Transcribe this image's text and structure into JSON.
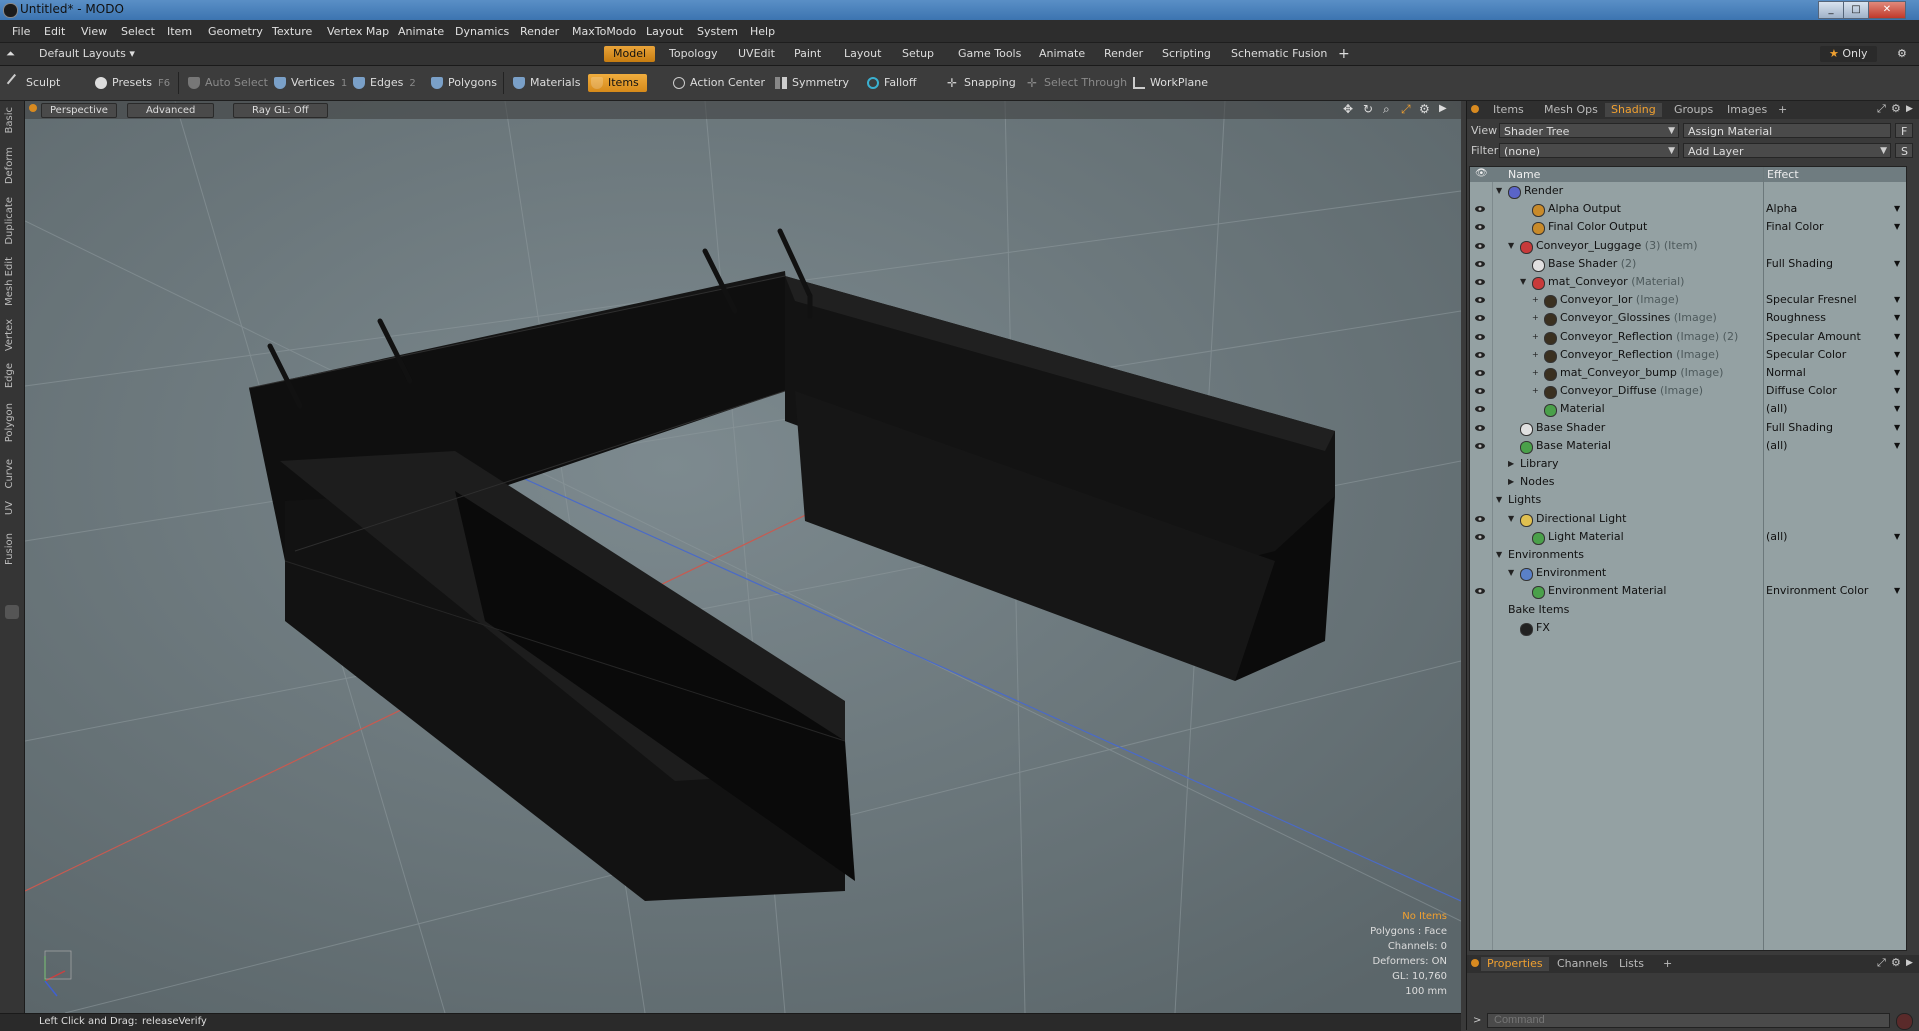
{
  "window": {
    "title": "Untitled* - MODO"
  },
  "menu": [
    "File",
    "Edit",
    "View",
    "Select",
    "Item",
    "Geometry",
    "Texture",
    "Vertex Map",
    "Animate",
    "Dynamics",
    "Render",
    "MaxToModo",
    "Layout",
    "System",
    "Help"
  ],
  "layoutbar": {
    "layout_name": "Default Layouts",
    "tabs": [
      "Model",
      "Topology",
      "UVEdit",
      "Paint",
      "Layout",
      "Setup",
      "Game Tools",
      "Animate",
      "Render",
      "Scripting",
      "Schematic Fusion"
    ],
    "active_tab": "Model",
    "add": "+",
    "only": "Only"
  },
  "toolbar": {
    "sculpt": "Sculpt",
    "presets": "Presets",
    "presets_key": "F6",
    "auto_select": "Auto Select",
    "vertices": "Vertices",
    "vertices_key": "1",
    "edges": "Edges",
    "edges_key": "2",
    "polygons": "Polygons",
    "materials": "Materials",
    "items": "Items",
    "action_center": "Action Center",
    "symmetry": "Symmetry",
    "falloff": "Falloff",
    "snapping": "Snapping",
    "select_through": "Select Through",
    "workplane": "WorkPlane"
  },
  "left_tabs": [
    "Basic",
    "Deform",
    "Duplicate",
    "Mesh Edit",
    "Vertex",
    "Edge",
    "Polygon",
    "Curve",
    "UV",
    "Fusion"
  ],
  "viewport": {
    "perspective": "Perspective",
    "advanced": "Advanced",
    "raygl": "Ray GL: Off",
    "stats": {
      "no_items": "No Items",
      "polygons": "Polygons : Face",
      "channels": "Channels: 0",
      "deformers": "Deformers: ON",
      "gl": "GL: 10,760",
      "scale": "100 mm"
    }
  },
  "statusbar": {
    "hint": "Left Click and Drag:",
    "action": "releaseVerify"
  },
  "panel": {
    "tabs": [
      "Items",
      "Mesh Ops",
      "Shading",
      "Groups",
      "Images"
    ],
    "active_tab": "Shading",
    "add": "+",
    "view_label": "View",
    "view_value": "Shader Tree",
    "assign_material": "Assign Material",
    "assign_key": "F",
    "filter_label": "Filter",
    "filter_value": "(none)",
    "add_layer": "Add Layer",
    "add_layer_key": "S",
    "col_name": "Name",
    "col_effect": "Effect",
    "rows": [
      {
        "name": "Render",
        "sub": "",
        "effect": "",
        "indent": 0,
        "tri": "▼",
        "icon": "#5a64c8",
        "eye": false
      },
      {
        "name": "Alpha Output",
        "sub": "",
        "effect": "Alpha",
        "indent": 2,
        "tri": "",
        "icon": "#c88a2a",
        "eye": true
      },
      {
        "name": "Final Color Output",
        "sub": "",
        "effect": "Final Color",
        "indent": 2,
        "tri": "",
        "icon": "#c88a2a",
        "eye": true
      },
      {
        "name": "Conveyor_Luggage",
        "sub": " (3) (Item)",
        "effect": "",
        "indent": 1,
        "tri": "▼",
        "icon": "#c83a3a",
        "eye": true
      },
      {
        "name": "Base Shader",
        "sub": " (2)",
        "effect": "Full Shading",
        "indent": 2,
        "tri": "",
        "icon": "#e0e0e0",
        "eye": true
      },
      {
        "name": "mat_Conveyor",
        "sub": " (Material)",
        "effect": "",
        "indent": 2,
        "tri": "▼",
        "icon": "#c83a3a",
        "eye": true
      },
      {
        "name": "Conveyor_Ior",
        "sub": " (Image)",
        "effect": "Specular Fresnel",
        "indent": 3,
        "tri": "+",
        "icon": "#3a3020",
        "eye": true
      },
      {
        "name": "Conveyor_Glossines",
        "sub": " (Image)",
        "effect": "Roughness",
        "indent": 3,
        "tri": "+",
        "icon": "#3a3020",
        "eye": true
      },
      {
        "name": "Conveyor_Reflection",
        "sub": " (Image) (2)",
        "effect": "Specular Amount",
        "indent": 3,
        "tri": "+",
        "icon": "#3a3020",
        "eye": true
      },
      {
        "name": "Conveyor_Reflection",
        "sub": " (Image)",
        "effect": "Specular Color",
        "indent": 3,
        "tri": "+",
        "icon": "#3a3020",
        "eye": true
      },
      {
        "name": "mat_Conveyor_bump",
        "sub": " (Image)",
        "effect": "Normal",
        "indent": 3,
        "tri": "+",
        "icon": "#3a3020",
        "eye": true
      },
      {
        "name": "Conveyor_Diffuse",
        "sub": " (Image)",
        "effect": "Diffuse Color",
        "indent": 3,
        "tri": "+",
        "icon": "#3a3020",
        "eye": true
      },
      {
        "name": "Material",
        "sub": "",
        "effect": "(all)",
        "indent": 3,
        "tri": "",
        "icon": "#4aa04a",
        "eye": true
      },
      {
        "name": "Base Shader",
        "sub": "",
        "effect": "Full Shading",
        "indent": 1,
        "tri": "",
        "icon": "#e0e0e0",
        "eye": true
      },
      {
        "name": "Base Material",
        "sub": "",
        "effect": "(all)",
        "indent": 1,
        "tri": "",
        "icon": "#4aa04a",
        "eye": true
      },
      {
        "name": "Library",
        "sub": "",
        "effect": "",
        "indent": 1,
        "tri": "▶",
        "icon": "",
        "eye": false
      },
      {
        "name": "Nodes",
        "sub": "",
        "effect": "",
        "indent": 1,
        "tri": "▶",
        "icon": "",
        "eye": false
      },
      {
        "name": "Lights",
        "sub": "",
        "effect": "",
        "indent": 0,
        "tri": "▼",
        "icon": "",
        "eye": false
      },
      {
        "name": "Directional Light",
        "sub": "",
        "effect": "",
        "indent": 1,
        "tri": "▼",
        "icon": "#e0c050",
        "eye": true
      },
      {
        "name": "Light Material",
        "sub": "",
        "effect": "(all)",
        "indent": 2,
        "tri": "",
        "icon": "#4aa04a",
        "eye": true
      },
      {
        "name": "Environments",
        "sub": "",
        "effect": "",
        "indent": 0,
        "tri": "▼",
        "icon": "",
        "eye": false
      },
      {
        "name": "Environment",
        "sub": "",
        "effect": "",
        "indent": 1,
        "tri": "▼",
        "icon": "#5a80c8",
        "eye": false
      },
      {
        "name": "Environment Material",
        "sub": "",
        "effect": "Environment Color",
        "indent": 2,
        "tri": "",
        "icon": "#4aa04a",
        "eye": true
      },
      {
        "name": "Bake Items",
        "sub": "",
        "effect": "",
        "indent": 0,
        "tri": "",
        "icon": "",
        "eye": false
      },
      {
        "name": "FX",
        "sub": "",
        "effect": "",
        "indent": 1,
        "tri": "",
        "icon": "#222222",
        "eye": false
      }
    ],
    "bottom_tabs": [
      "Properties",
      "Channels",
      "Lists"
    ],
    "bottom_active": "Properties",
    "command_placeholder": "Command"
  }
}
